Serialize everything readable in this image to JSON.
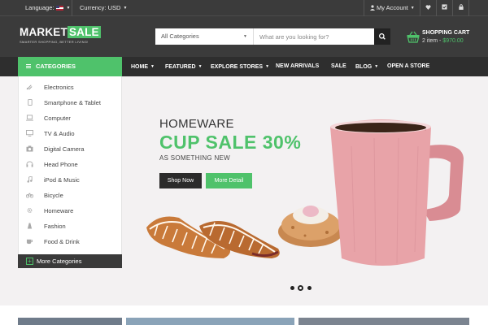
{
  "topbar": {
    "language_label": "Language:",
    "currency_label": "Currency: USD",
    "account_label": "My Account"
  },
  "header": {
    "logo_main": "MARKET",
    "logo_accent": "SALE",
    "logo_tagline": "SMARTER SHOPPING, BETTER LIVING!",
    "search": {
      "category": "All Categories",
      "placeholder": "What are you looking for?"
    },
    "cart": {
      "title": "SHOPPING CART",
      "items": "2 item - ",
      "total": "$970.00"
    }
  },
  "nav": {
    "categories_label": "CATEGORIES",
    "items": [
      "HOME",
      "FEATURED",
      "EXPLORE STORES",
      "NEW ARRIVALS",
      "SALE",
      "BLOG",
      "OPEN A STORE"
    ]
  },
  "sidebar": {
    "items": [
      "Electronics",
      "Smartphone & Tablet",
      "Computer",
      "TV & Audio",
      "Digital Camera",
      "Head Phone",
      "iPod & Music",
      "Bicycle",
      "Homeware",
      "Fashion",
      "Food & Drink"
    ],
    "more_label": "More Categories"
  },
  "hero": {
    "kicker": "HOMEWARE",
    "title": "CUP SALE 30%",
    "subtitle": "AS SOMETHING NEW",
    "shop_button": "Shop Now",
    "detail_button": "More Detail",
    "slides": 3,
    "active_slide": 2
  },
  "colors": {
    "accent": "#4fc26b",
    "header_bg": "#3b3b3b",
    "nav_bg": "#2e2e2e",
    "hero_bg": "#f3f1f2",
    "mug": "#e8a3a8"
  }
}
